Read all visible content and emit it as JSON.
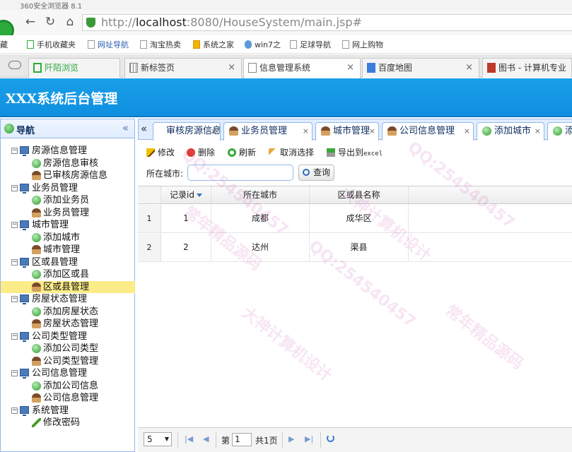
{
  "browser": {
    "window_title": "360安全浏览器 8.1",
    "url_prefix": "http://",
    "url_host": "localhost",
    "url_rest": ":8080/HouseSystem/main.jsp#",
    "bookmarks": [
      "藏",
      "手机收藏夹",
      "网址导航",
      "淘宝热卖",
      "系统之家",
      "win7之",
      "足球导航",
      "网上购物"
    ],
    "tabs": [
      {
        "label": "阡陌浏览"
      },
      {
        "label": "新标签页"
      },
      {
        "label": "信息管理系统"
      },
      {
        "label": "百度地图"
      },
      {
        "label": "图书 - 计算机专业"
      }
    ]
  },
  "app": {
    "title": "XXX系统后台管理"
  },
  "nav": {
    "title": "导航",
    "collapse": "«",
    "groups": [
      {
        "label": "房源信息管理",
        "items": [
          {
            "label": "房源信息审核",
            "icon": "add"
          },
          {
            "label": "已审核房源信息",
            "icon": "person"
          }
        ]
      },
      {
        "label": "业务员管理",
        "items": [
          {
            "label": "添加业务员",
            "icon": "add"
          },
          {
            "label": "业务员管理",
            "icon": "person"
          }
        ]
      },
      {
        "label": "城市管理",
        "items": [
          {
            "label": "添加城市",
            "icon": "add"
          },
          {
            "label": "城市管理",
            "icon": "person"
          }
        ]
      },
      {
        "label": "区或县管理",
        "items": [
          {
            "label": "添加区或县",
            "icon": "add"
          },
          {
            "label": "区或县管理",
            "icon": "person"
          }
        ]
      },
      {
        "label": "房屋状态管理",
        "items": [
          {
            "label": "添加房屋状态",
            "icon": "add"
          },
          {
            "label": "房屋状态管理",
            "icon": "person"
          }
        ]
      },
      {
        "label": "公司类型管理",
        "items": [
          {
            "label": "添加公司类型",
            "icon": "add"
          },
          {
            "label": "公司类型管理",
            "icon": "person"
          }
        ]
      },
      {
        "label": "公司信息管理",
        "items": [
          {
            "label": "添加公司信息",
            "icon": "add"
          },
          {
            "label": "公司信息管理",
            "icon": "person"
          }
        ]
      },
      {
        "label": "系统管理",
        "items": [
          {
            "label": "修改密码",
            "icon": "pencil"
          }
        ]
      }
    ],
    "selected": "区或县管理"
  },
  "center_tabs": {
    "scroll_left": "«",
    "tabs": [
      {
        "label": "审核房源信息",
        "icon": "none"
      },
      {
        "label": "业务员管理",
        "icon": "person"
      },
      {
        "label": "城市管理",
        "icon": "person"
      },
      {
        "label": "公司信息管理",
        "icon": "person"
      },
      {
        "label": "添加城市",
        "icon": "add"
      },
      {
        "label": "添",
        "icon": "add"
      }
    ],
    "close": "×"
  },
  "toolbar": {
    "edit": "修改",
    "delete": "删除",
    "refresh": "刷新",
    "cancel_select": "取消选择",
    "export_prefix": "导出到",
    "export_suffix": "excel"
  },
  "search": {
    "label": "所在城市:",
    "value": "",
    "button": "查询"
  },
  "table": {
    "columns": [
      "记录id",
      "所在城市",
      "区或县名称"
    ],
    "rows": [
      {
        "n": "1",
        "id": "1",
        "city": "成都",
        "district": "成华区"
      },
      {
        "n": "2",
        "id": "2",
        "city": "达州",
        "district": "渠县"
      }
    ]
  },
  "pager": {
    "page_size": "5",
    "page_label": "第",
    "page_value": "1",
    "total_label": "共1页"
  },
  "watermark": {
    "qq": "QQ:254540457",
    "slogan1": "大神计算机设计",
    "slogan2": "常年精品源码"
  }
}
